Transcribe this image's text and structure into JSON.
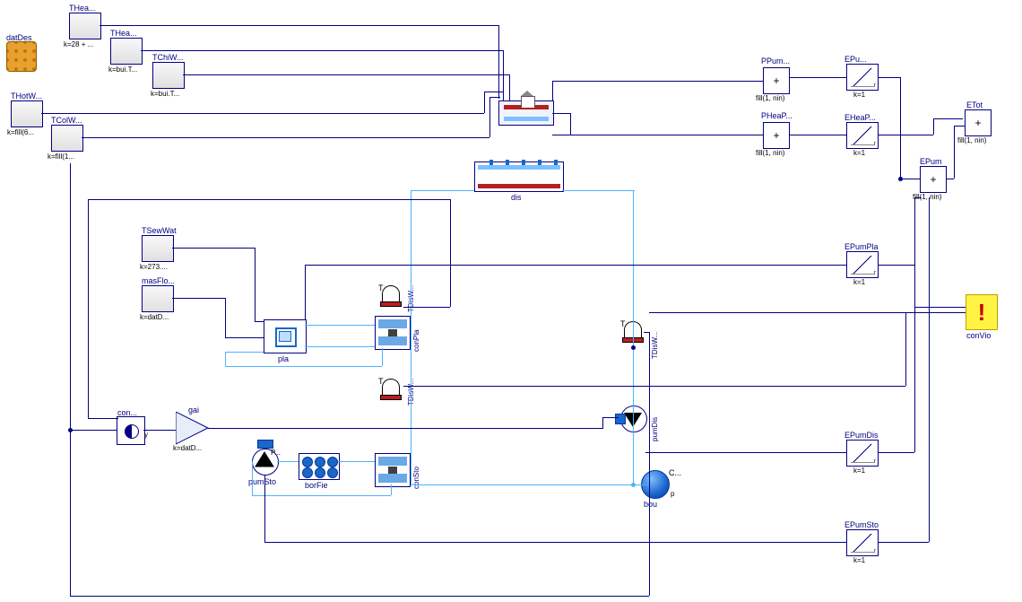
{
  "blocks": {
    "datDes": {
      "label": "datDes"
    },
    "THea1": {
      "label": "THea...",
      "sub": "k=28 + ..."
    },
    "THea2": {
      "label": "THea...",
      "sub": "k=bui.T..."
    },
    "TChiW": {
      "label": "TChiW...",
      "sub": "k=bui.T..."
    },
    "THotW": {
      "label": "THotW...",
      "sub": "k=fill(6..."
    },
    "TColW": {
      "label": "TColW...",
      "sub": "k=fill(1..."
    },
    "TSewWat": {
      "label": "TSewWat",
      "sub": "k=273...."
    },
    "masFlo": {
      "label": "masFlo...",
      "sub": "k=datD..."
    },
    "con": {
      "label": "con..."
    },
    "gai": {
      "label": "gai",
      "sub": "k=datD..."
    },
    "pla": {
      "label": "pla"
    },
    "dis": {
      "label": "dis"
    },
    "bui": {
      "label": ""
    },
    "pumSto": {
      "label": "pumSto"
    },
    "borFie": {
      "label": "borFie"
    },
    "conSto": {
      "label": "conSto"
    },
    "conPla": {
      "label": "conPla"
    },
    "pumDis": {
      "label": "pumDis"
    },
    "bou": {
      "label": "bou",
      "p": "p"
    },
    "TDisWSupRetLow": {
      "label": "TDisW..."
    },
    "TDisWSupPla": {
      "label": "TDisW..."
    },
    "TDisWRight": {
      "label": "TDisW..."
    },
    "PPum": {
      "label": "PPum...",
      "sub": "fill(1, nin)"
    },
    "PHeaP": {
      "label": "PHeaP...",
      "sub": "fill(1, nin)"
    },
    "EPumTop": {
      "label": "EPu...",
      "sub": "k=1"
    },
    "EHeaP": {
      "label": "EHeaP...",
      "sub": "k=1"
    },
    "ETot": {
      "label": "ETot",
      "sub": "fill(1, nin)"
    },
    "EPum": {
      "label": "EPum",
      "sub": "fill(1, nin)"
    },
    "EPumPla": {
      "label": "EPumPla",
      "sub": "k=1"
    },
    "EPumDis": {
      "label": "EPumDis",
      "sub": "k=1"
    },
    "EPumSto": {
      "label": "EPumSto",
      "sub": "k=1"
    },
    "conVio": {
      "label": "conVio"
    }
  }
}
